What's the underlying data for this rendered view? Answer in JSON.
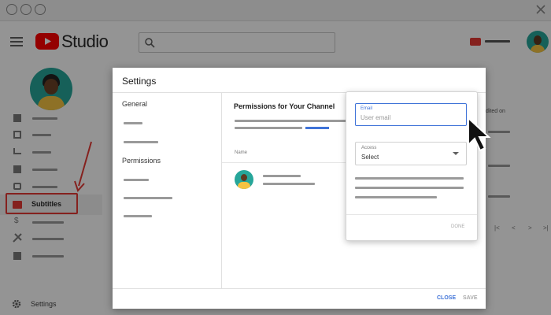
{
  "app": {
    "logo_text": "Studio",
    "colors": {
      "brand_red": "#ff0000",
      "accent_blue": "#3f73d8",
      "highlight_red": "#e53935"
    }
  },
  "header": {
    "search_icon": "search-icon",
    "create_icon": "video-camera-icon"
  },
  "sidebar": {
    "items": [
      {
        "icon": "dashboard-icon",
        "label": ""
      },
      {
        "icon": "content-icon",
        "label": ""
      },
      {
        "icon": "analytics-icon",
        "label": ""
      },
      {
        "icon": "comments-icon",
        "label": ""
      },
      {
        "icon": "chat-icon",
        "label": ""
      },
      {
        "icon": "subtitles-icon",
        "label": "Subtitles"
      },
      {
        "icon": "monetization-icon",
        "label": ""
      },
      {
        "icon": "customization-icon",
        "label": ""
      },
      {
        "icon": "audio-library-icon",
        "label": ""
      }
    ],
    "settings_label": "Settings"
  },
  "background_table": {
    "column_header_fragment": "dited on"
  },
  "dialog": {
    "title": "Settings",
    "nav": {
      "general_label": "General",
      "permissions_label": "Permissions"
    },
    "content": {
      "heading": "Permissions for Your Channel",
      "name_column": "Name"
    },
    "actions": {
      "close_label": "CLOSE",
      "save_label": "SAVE"
    }
  },
  "invite_popup": {
    "email_label": "Email",
    "email_placeholder": "User email",
    "access_label": "Access",
    "access_value": "Select",
    "done_label": "DONE"
  }
}
